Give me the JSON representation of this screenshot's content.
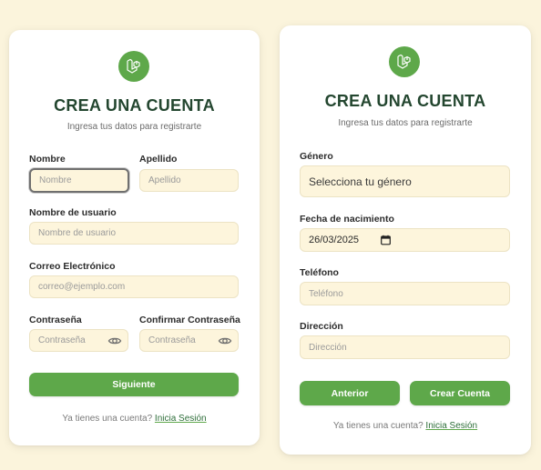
{
  "brand": {
    "accent": "#5ea84a",
    "logo_icon": "laravel-logo-icon"
  },
  "register_step1": {
    "title": "CREA UNA CUENTA",
    "subtitle": "Ingresa tus datos para registrarte",
    "fields": {
      "first_name": {
        "label": "Nombre",
        "placeholder": "Nombre"
      },
      "last_name": {
        "label": "Apellido",
        "placeholder": "Apellido"
      },
      "username": {
        "label": "Nombre de usuario",
        "placeholder": "Nombre de usuario"
      },
      "email": {
        "label": "Correo Electrónico",
        "placeholder": "correo@ejemplo.com"
      },
      "password": {
        "label": "Contraseña",
        "placeholder": "Contraseña"
      },
      "confirm_password": {
        "label": "Confirmar Contraseña",
        "placeholder": "Contraseña"
      }
    },
    "next_button": "Siguiente",
    "footer_text": "Ya tienes una cuenta?",
    "footer_link": "Inicia Sesión"
  },
  "register_step2": {
    "title": "CREA UNA CUENTA",
    "subtitle": "Ingresa tus datos para registrarte",
    "fields": {
      "gender": {
        "label": "Género",
        "value": "Selecciona tu género"
      },
      "birthdate": {
        "label": "Fecha de nacimiento",
        "value": "26/03/2025"
      },
      "phone": {
        "label": "Teléfono",
        "placeholder": "Teléfono"
      },
      "address": {
        "label": "Dirección",
        "placeholder": "Dirección"
      }
    },
    "back_button": "Anterior",
    "create_button": "Crear Cuenta",
    "footer_text": "Ya tienes una cuenta?",
    "footer_link": "Inicia Sesión"
  }
}
